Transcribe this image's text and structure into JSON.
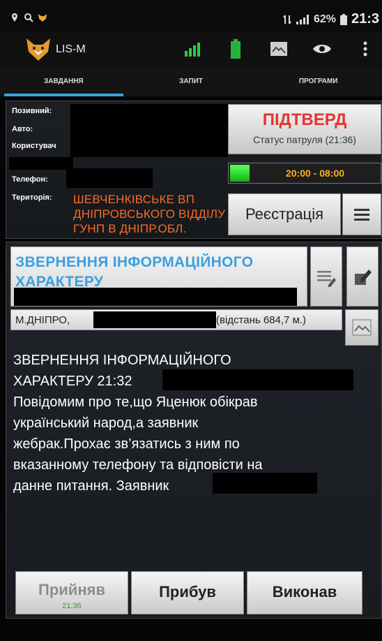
{
  "status_bar": {
    "battery_percent": "62%",
    "time": "21:3",
    "left_icons": [
      "location-icon",
      "search-icon",
      "fox-notification-icon"
    ],
    "right_icons": [
      "data-icon",
      "signal-icon",
      "battery-icon"
    ]
  },
  "action_bar": {
    "app_title": "LIS-M",
    "icons": [
      "signal-bars-icon",
      "battery-level-icon",
      "map-icon",
      "eye-icon",
      "overflow-menu-icon"
    ]
  },
  "tabs": [
    {
      "label": "ЗАВДАННЯ",
      "active": true
    },
    {
      "label": "ЗАПИТ",
      "active": false
    },
    {
      "label": "ПРОГРАМИ",
      "active": false
    }
  ],
  "info": {
    "callsign_label": "Позивний:",
    "car_label": "Авто:",
    "user_label": "Користувач",
    "phone_label": "Телефон:",
    "territory_label": "Територія:",
    "territory_value": "ШЕВЧЕНКІВСЬКЕ ВП ДНІПРОВСЬКОГО ВІДДІЛУ ГУНП В ДНІПР.ОБЛ.",
    "confirm_title": "ПІДТВЕРД",
    "patrol_status": "Статус патруля (21:36)",
    "shift_time": "20:00 - 08:00",
    "register_label": "Реєстрація"
  },
  "task": {
    "type_title": "ЗВЕРНЕННЯ ІНФОРМАЦІЙНОГО ХАРАКТЕРУ",
    "address_city": "М.ДНІПРО,",
    "distance": "(відстань 684,7 м.)",
    "message_lines": [
      "ЗВЕРНЕННЯ ІНФОРМАЦІЙНОГО",
      "ХАРАКТЕРУ 21:32",
      "Повідомим про те,що Яценюк обікрав",
      "український народ,а заявник",
      "жебрак.Прохає зв’язатись з ним по",
      "вказанному телефону та відповісти на",
      "данне питання. Заявник"
    ]
  },
  "actions": {
    "accepted_label": "Прийняв",
    "accepted_time": "21:36",
    "arrived_label": "Прибув",
    "done_label": "Виконав"
  },
  "colors": {
    "tab_indicator": "#35a6e0",
    "territory_text": "#ff6a24",
    "confirm_text": "#e53434",
    "shift_text": "#ffb020",
    "shift_led": "#2ede2e",
    "task_title": "#3aa0e0",
    "accepted_time": "#2a9a2a"
  }
}
